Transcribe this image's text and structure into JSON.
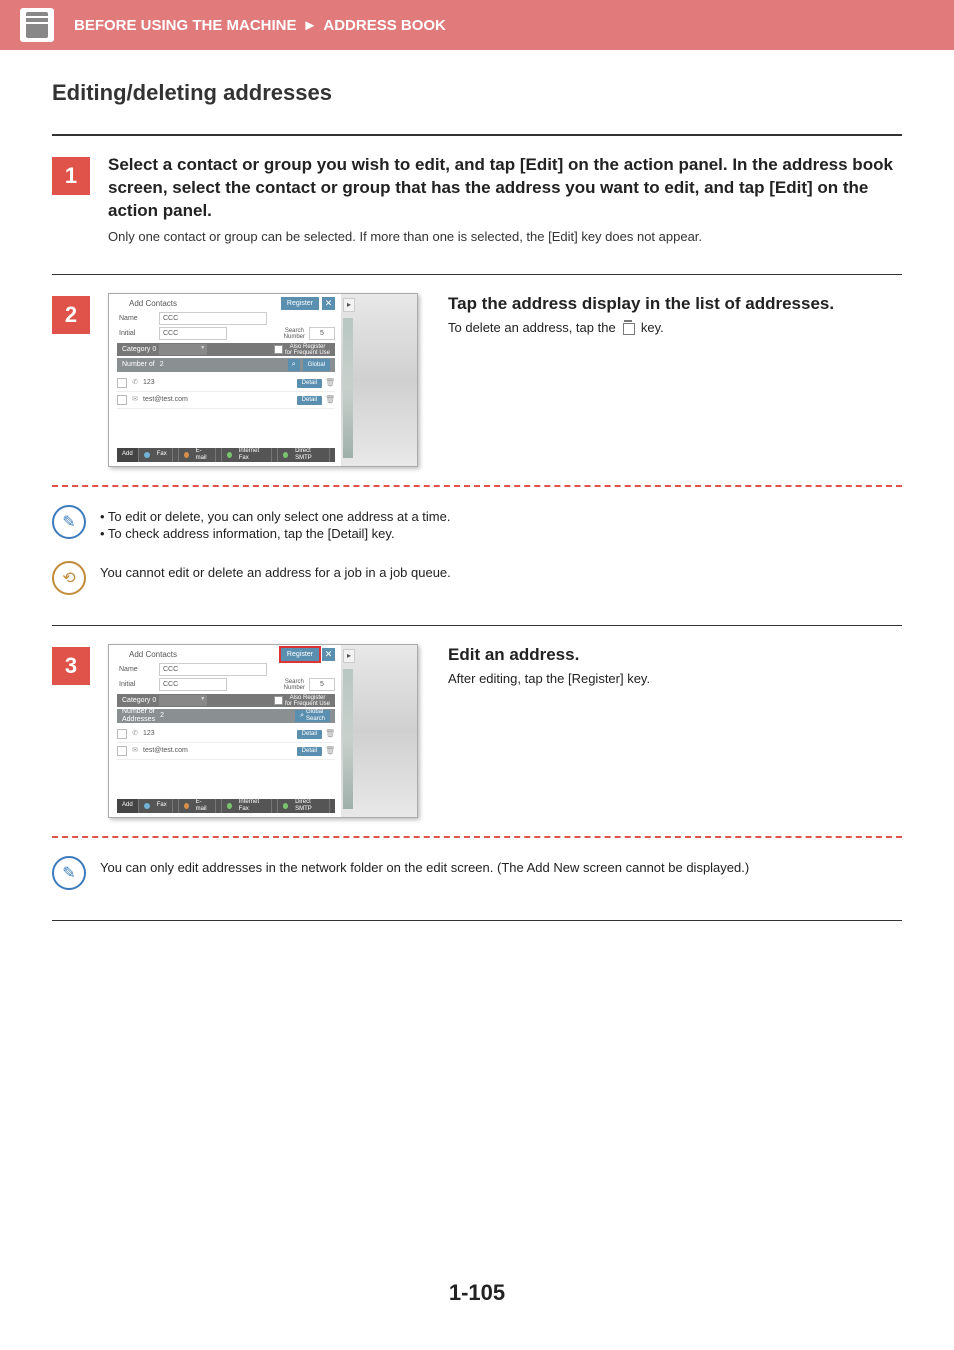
{
  "header": {
    "section": "BEFORE USING THE MACHINE",
    "breadcrumb_arrow": "►",
    "subsection": "ADDRESS BOOK"
  },
  "page": {
    "title": "Editing/deleting addresses",
    "number": "1-105"
  },
  "steps": {
    "s1": {
      "num": "1",
      "title": "Select a contact or group you wish to edit, and tap [Edit]  on the action panel. In the address book screen, select the contact or group that has the address you want to edit, and tap [Edit] on the action panel.",
      "desc": "Only one contact or group can be selected. If more than one is selected, the [Edit] key does not appear."
    },
    "s2": {
      "num": "2",
      "title": "Tap the address display in the list of addresses.",
      "desc_pre": "To delete an address, tap the ",
      "desc_post": " key."
    },
    "s3": {
      "num": "3",
      "title": "Edit an address.",
      "desc": "After editing, tap the [Register] key."
    }
  },
  "screenshot": {
    "screen_title": "Add Contacts",
    "register": "Register",
    "close": "✕",
    "name_label": "Name",
    "name_value": "CCC",
    "initial_label": "Initial",
    "initial_value": "CCC",
    "search_number_label": "Search\nNumber",
    "search_number_value": "5",
    "category_label": "Category 0",
    "also_register": "Also Register\nfor Frequent Use",
    "num_of_addr_s2": "Number of",
    "num_of_addr_s3": "Number of\nAddresses",
    "num_of_addr_val": "2",
    "global_search_s2": "Global",
    "global_search_s3": "Global\nSearch",
    "list": [
      {
        "icon": "phone",
        "text": "123",
        "detail": "Detail",
        "del": "🗑"
      },
      {
        "icon": "mail",
        "text": "test@test.com",
        "detail": "Detail",
        "del": "🗑"
      }
    ],
    "bottom": {
      "add": "Add",
      "fax": "Fax",
      "email": "E-mail",
      "ifax": "Internet Fax",
      "smtp": "Direct SMTP"
    },
    "side_arrow": "▸"
  },
  "notes": {
    "n1a": "• To edit or delete, you can only select one address at a time.",
    "n1b": "• To check address information, tap the [Detail] key.",
    "n2": "You cannot edit or delete an address for a job in a job queue.",
    "n3": "You can only edit addresses in the network folder on the edit screen. (The Add New screen cannot be displayed.)"
  }
}
